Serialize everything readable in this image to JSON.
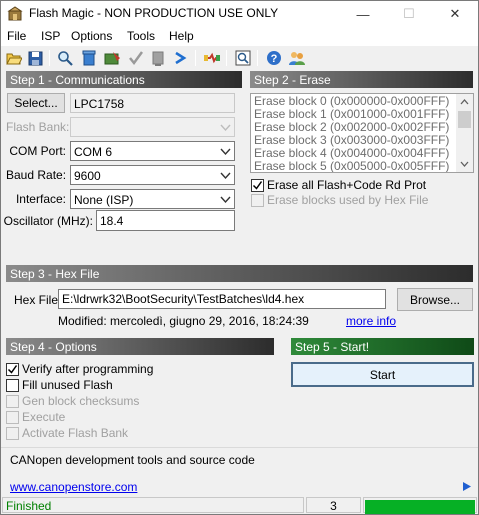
{
  "window": {
    "title": "Flash Magic - NON PRODUCTION USE ONLY",
    "minimize_symbol": "—",
    "maximize_symbol": "☐",
    "close_symbol": "✕"
  },
  "menu": [
    "File",
    "ISP",
    "Options",
    "Tools",
    "Help"
  ],
  "toolbar": {
    "icons": [
      "open-icon",
      "save-icon",
      "search-icon",
      "erase-icon",
      "program-icon",
      "verify-icon",
      "blank-check-icon",
      "go-icon",
      "cable-icon",
      "view-buffer-icon",
      "help-icon",
      "users-icon"
    ]
  },
  "step1": {
    "header": "Step 1 - Communications",
    "select_button": "Select...",
    "device": "LPC1758",
    "flash_bank_label": "Flash Bank:",
    "com_port_label": "COM Port:",
    "com_port_value": "COM 6",
    "baud_rate_label": "Baud Rate:",
    "baud_rate_value": "9600",
    "interface_label": "Interface:",
    "interface_value": "None (ISP)",
    "oscillator_label": "Oscillator (MHz):",
    "oscillator_value": "18.4"
  },
  "step2": {
    "header": "Step 2 - Erase",
    "blocks": [
      "Erase block 0 (0x000000-0x000FFF)",
      "Erase block 1 (0x001000-0x001FFF)",
      "Erase block 2 (0x002000-0x002FFF)",
      "Erase block 3 (0x003000-0x003FFF)",
      "Erase block 4 (0x004000-0x004FFF)",
      "Erase block 5 (0x005000-0x005FFF)"
    ],
    "erase_all_label": "Erase all Flash+Code Rd Prot",
    "erase_all_checked": true,
    "erase_used_label": "Erase blocks used by Hex File",
    "erase_used_checked": false
  },
  "step3": {
    "header": "Step 3 - Hex File",
    "hex_label": "Hex File:",
    "hex_path": "E:\\ldrwrk32\\BootSecurity\\TestBatches\\ld4.hex",
    "browse_button": "Browse...",
    "modified": "Modified: mercoledì, giugno 29, 2016, 18:24:39",
    "more_info": "more info"
  },
  "step4": {
    "header": "Step 4 - Options",
    "options": [
      {
        "label": "Verify after programming",
        "checked": true,
        "enabled": true
      },
      {
        "label": "Fill unused Flash",
        "checked": false,
        "enabled": true
      },
      {
        "label": "Gen block checksums",
        "checked": false,
        "enabled": false
      },
      {
        "label": "Execute",
        "checked": false,
        "enabled": false
      },
      {
        "label": "Activate Flash Bank",
        "checked": false,
        "enabled": false
      }
    ]
  },
  "step5": {
    "header": "Step 5 - Start!",
    "start_button": "Start"
  },
  "info": {
    "text": "CANopen development tools and source code",
    "link": "www.canopenstore.com"
  },
  "status": {
    "text": "Finished",
    "count": "3",
    "progress": 1.0,
    "text_color": "#008000"
  }
}
